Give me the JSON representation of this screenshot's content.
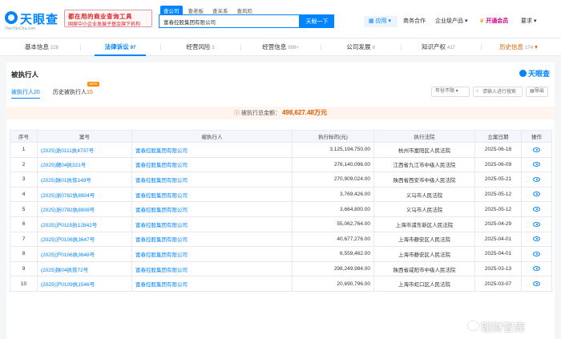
{
  "header": {
    "logo_text": "天眼查",
    "logo_url": "TianYanCha.com",
    "ad_line1": "都在用的商业查询工具",
    "ad_line2": "国家中小企业发展子基金旗下机构",
    "search_tabs": [
      "查公司",
      "查老板",
      "查关系",
      "查风险"
    ],
    "search_value": "富春控股集团有限公司",
    "search_button": "天眼一下",
    "app_label": "应用",
    "nav": [
      "商务合作",
      "企业级产品"
    ],
    "vip_label": "开通会员",
    "user_label": "要求"
  },
  "tabs": [
    {
      "label": "基本信息",
      "count": "228"
    },
    {
      "label": "法律诉讼",
      "count": "97"
    },
    {
      "label": "经营风险",
      "count": "3"
    },
    {
      "label": "经营信息",
      "count": "999+"
    },
    {
      "label": "公司发展",
      "count": "9"
    },
    {
      "label": "知识产权",
      "count": "417"
    },
    {
      "label": "历史信息",
      "count": "174"
    }
  ],
  "section": {
    "title": "被执行人",
    "brand": "天眼查",
    "subtabs": [
      {
        "label": "被执行人",
        "count": "20"
      },
      {
        "label": "历史被执行人",
        "count": "15",
        "badge": "NEW"
      }
    ],
    "year_filter": "年份不限",
    "search_placeholder": "请输入进行搜索",
    "export_label": "导出",
    "total_label": "被执行总金额：",
    "total_amount": "498,627.48万元"
  },
  "table": {
    "columns": [
      "序号",
      "案号",
      "被执行人",
      "执行标的(元)",
      "执行法院",
      "立案日期",
      "操作"
    ],
    "rows": [
      [
        "1",
        "(2025)浙0111执4737号",
        "富春控股集团有限公司",
        "3,125,194,750.00",
        "杭州市富阳区人民法院",
        "2025-06-18"
      ],
      [
        "2",
        "(2025)赣04执321号",
        "富春控股集团有限公司",
        "276,140,096.00",
        "江西省九江市中级人民法院",
        "2025-06-09"
      ],
      [
        "3",
        "(2025)陕01执恢149号",
        "富春控股集团有限公司",
        "270,909,024.00",
        "陕西省西安市中级人民法院",
        "2025-05-21"
      ],
      [
        "4",
        "(2025)浙0782执8904号",
        "富春控股集团有限公司",
        "3,769,426.00",
        "义乌市人民法院",
        "2025-05-12"
      ],
      [
        "5",
        "(2025)浙0782执8908号",
        "富春控股集团有限公司",
        "3,664,800.00",
        "义乌市人民法院",
        "2025-05-12"
      ],
      [
        "6",
        "(2025)沪0115执12842号",
        "富春控股集团有限公司",
        "55,062,764.00",
        "上海市浦东新区人民法院",
        "2025-04-29"
      ],
      [
        "7",
        "(2025)沪0106执3647号",
        "富春控股集团有限公司",
        "40,677,276.00",
        "上海市静安区人民法院",
        "2025-04-01"
      ],
      [
        "8",
        "(2025)沪0106执3648号",
        "富春控股集团有限公司",
        "6,559,462.00",
        "上海市静安区人民法院",
        "2025-04-01"
      ],
      [
        "9",
        "(2025)陕04执恢72号",
        "富春控股集团有限公司",
        "298,249,984.00",
        "陕西省咸阳市中级人民法院",
        "2025-03-13"
      ],
      [
        "10",
        "(2025)沪0109执1546号",
        "富春控股集团有限公司",
        "20,690,796.00",
        "上海市虹口区人民法院",
        "2025-03-07"
      ]
    ],
    "action_icon": "eye-icon"
  },
  "watermark": "理财智库",
  "colors": {
    "accent": "#0084ff",
    "amount": "#e05a00",
    "total_bg": "#fff4ee"
  }
}
